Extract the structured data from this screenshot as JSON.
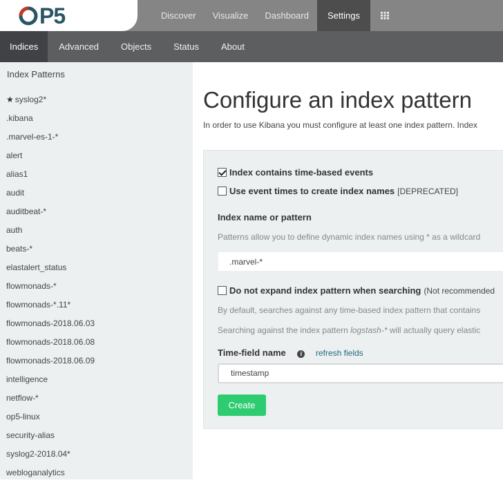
{
  "brand": {
    "logo_text": "P5",
    "accent": "#2a5565",
    "ring_color": "#c0392b"
  },
  "topnav": {
    "items": [
      "Discover",
      "Visualize",
      "Dashboard",
      "Settings"
    ],
    "active": "Settings",
    "apps_icon": "grid-icon"
  },
  "subnav": {
    "items": [
      "Indices",
      "Advanced",
      "Objects",
      "Status",
      "About"
    ],
    "active": "Indices"
  },
  "sidebar": {
    "title": "Index Patterns",
    "patterns": [
      "syslog2*",
      ".kibana",
      ".marvel-es-1-*",
      "alert",
      "alias1",
      "audit",
      "auditbeat-*",
      "auth",
      "beats-*",
      "elastalert_status",
      "flowmonads-*",
      "flowmonads-*.11*",
      "flowmonads-2018.06.03",
      "flowmonads-2018.06.08",
      "flowmonads-2018.06.09",
      "intelligence",
      "netflow-*",
      "op5-linux",
      "security-alias",
      "syslog2-2018.04*",
      "webloganalytics"
    ],
    "default_pattern": "syslog2*"
  },
  "main": {
    "title": "Configure an index pattern",
    "description": "In order to use Kibana you must configure at least one index pattern. Index",
    "time_based_label": "Index contains time-based events",
    "time_based_checked": true,
    "event_times_label": "Use event times to create index names",
    "event_times_note": "[DEPRECATED]",
    "event_times_checked": false,
    "index_name_label": "Index name or pattern",
    "index_name_help": "Patterns allow you to define dynamic index names using * as a wildcard",
    "index_name_value": ".marvel-*",
    "no_expand_label": "Do not expand index pattern when searching",
    "no_expand_note": "(Not recommended",
    "no_expand_checked": false,
    "no_expand_help1": "By default, searches against any time-based index pattern that contains",
    "no_expand_help2_prefix": "Searching against the index pattern",
    "no_expand_help2_em": "logstash-*",
    "no_expand_help2_suffix": "will actually query elastic",
    "time_field_label": "Time-field name",
    "refresh_label": "refresh fields",
    "time_field_value": "timestamp",
    "create_label": "Create",
    "create_color": "#2ecc71"
  }
}
